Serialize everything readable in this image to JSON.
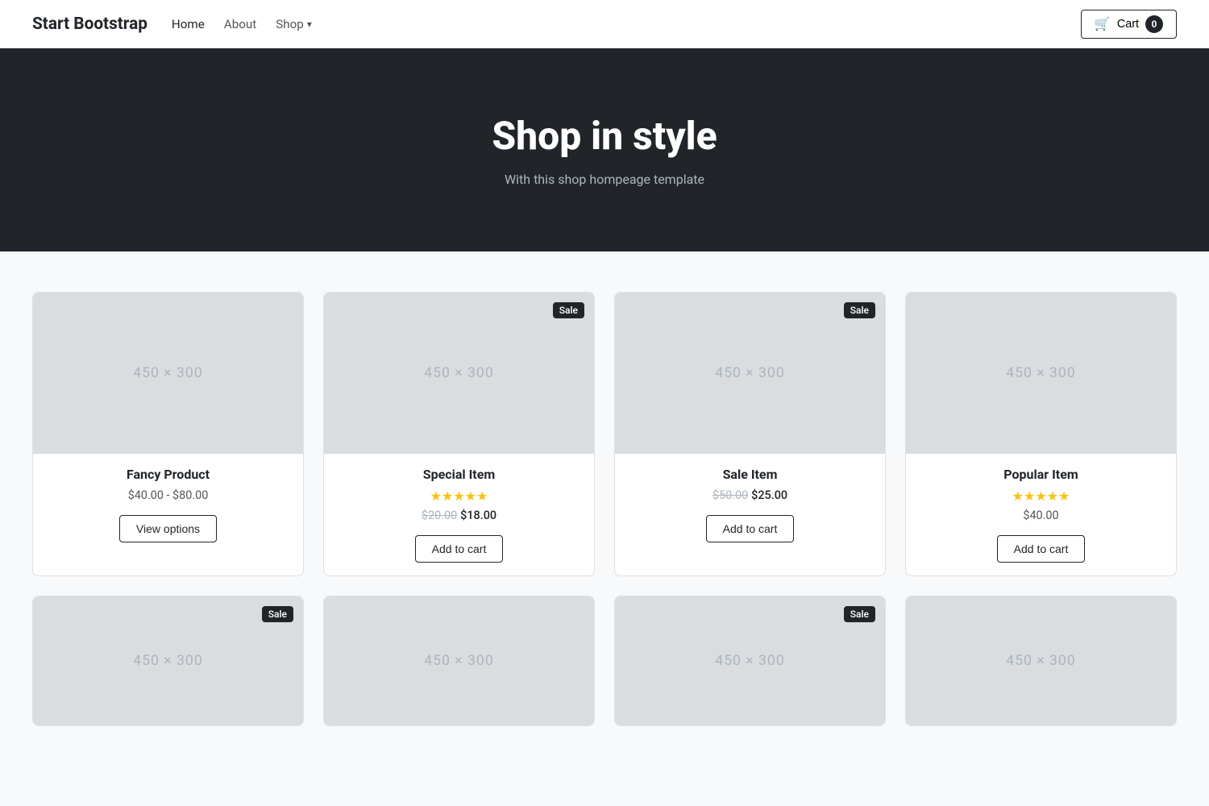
{
  "navbar": {
    "brand": "Start Bootstrap",
    "links": [
      {
        "label": "Home",
        "active": true
      },
      {
        "label": "About",
        "active": false
      },
      {
        "label": "Shop",
        "dropdown": true
      }
    ],
    "cart_label": "Cart",
    "cart_count": "0"
  },
  "hero": {
    "title": "Shop in style",
    "subtitle": "With this shop hompeage template"
  },
  "products": [
    {
      "name": "Fancy Product",
      "price_range": "$40.00 - $80.00",
      "has_sale_badge": false,
      "has_stars": false,
      "original_price": null,
      "sale_price": null,
      "button_label": "View options",
      "placeholder": "450 × 300"
    },
    {
      "name": "Special Item",
      "price_range": null,
      "has_sale_badge": true,
      "has_stars": true,
      "star_count": 5,
      "original_price": "$20.00",
      "sale_price": "$18.00",
      "button_label": "Add to cart",
      "placeholder": "450 × 300"
    },
    {
      "name": "Sale Item",
      "price_range": null,
      "has_sale_badge": true,
      "has_stars": false,
      "original_price": "$50.00",
      "sale_price": "$25.00",
      "button_label": "Add to cart",
      "placeholder": "450 × 300"
    },
    {
      "name": "Popular Item",
      "price_range": null,
      "has_sale_badge": false,
      "has_stars": true,
      "star_count": 5,
      "original_price": null,
      "sale_price": null,
      "single_price": "$40.00",
      "button_label": "Add to cart",
      "placeholder": "450 × 300"
    }
  ],
  "products_row2": [
    {
      "has_sale_badge": true,
      "placeholder": "450 × 300"
    },
    {
      "has_sale_badge": false,
      "placeholder": "450 × 300"
    },
    {
      "has_sale_badge": true,
      "placeholder": "450 × 300"
    },
    {
      "has_sale_badge": false,
      "placeholder": "450 × 300"
    }
  ],
  "sale_badge_label": "Sale"
}
